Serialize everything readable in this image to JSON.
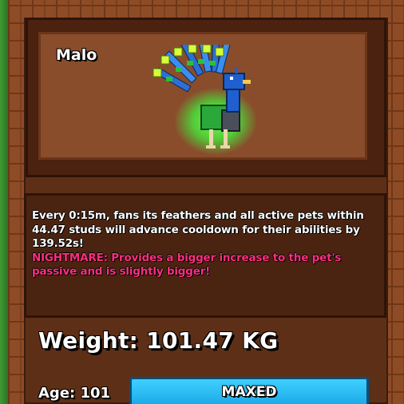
{
  "pet": {
    "name": "Malo"
  },
  "description": {
    "line1": "Every 0:15m, fans its feathers and all active pets within",
    "line2": "44.47 studs will advance cooldown for their abilities by",
    "line3": "139.52s!",
    "nightmare_label": "NIGHTMARE:",
    "nightmare_line1_rest": " Provides a bigger increase to the pet's",
    "nightmare_line2": "passive and is slightly bigger!"
  },
  "stats": {
    "weight_text": "Weight: 101.47 KG",
    "age_text": "Age: 101"
  },
  "buttons": {
    "maxed_label": "MAXED"
  },
  "colors": {
    "nightmare_text": "#ff2f7e",
    "maxed_button": "#2ab8f2",
    "panel_brown": "#8a4d2c",
    "frame_brick": "#8e4c26",
    "pet_glow": "#3cff3c"
  },
  "icons": {
    "pet_image": "peacock-pet-icon"
  }
}
